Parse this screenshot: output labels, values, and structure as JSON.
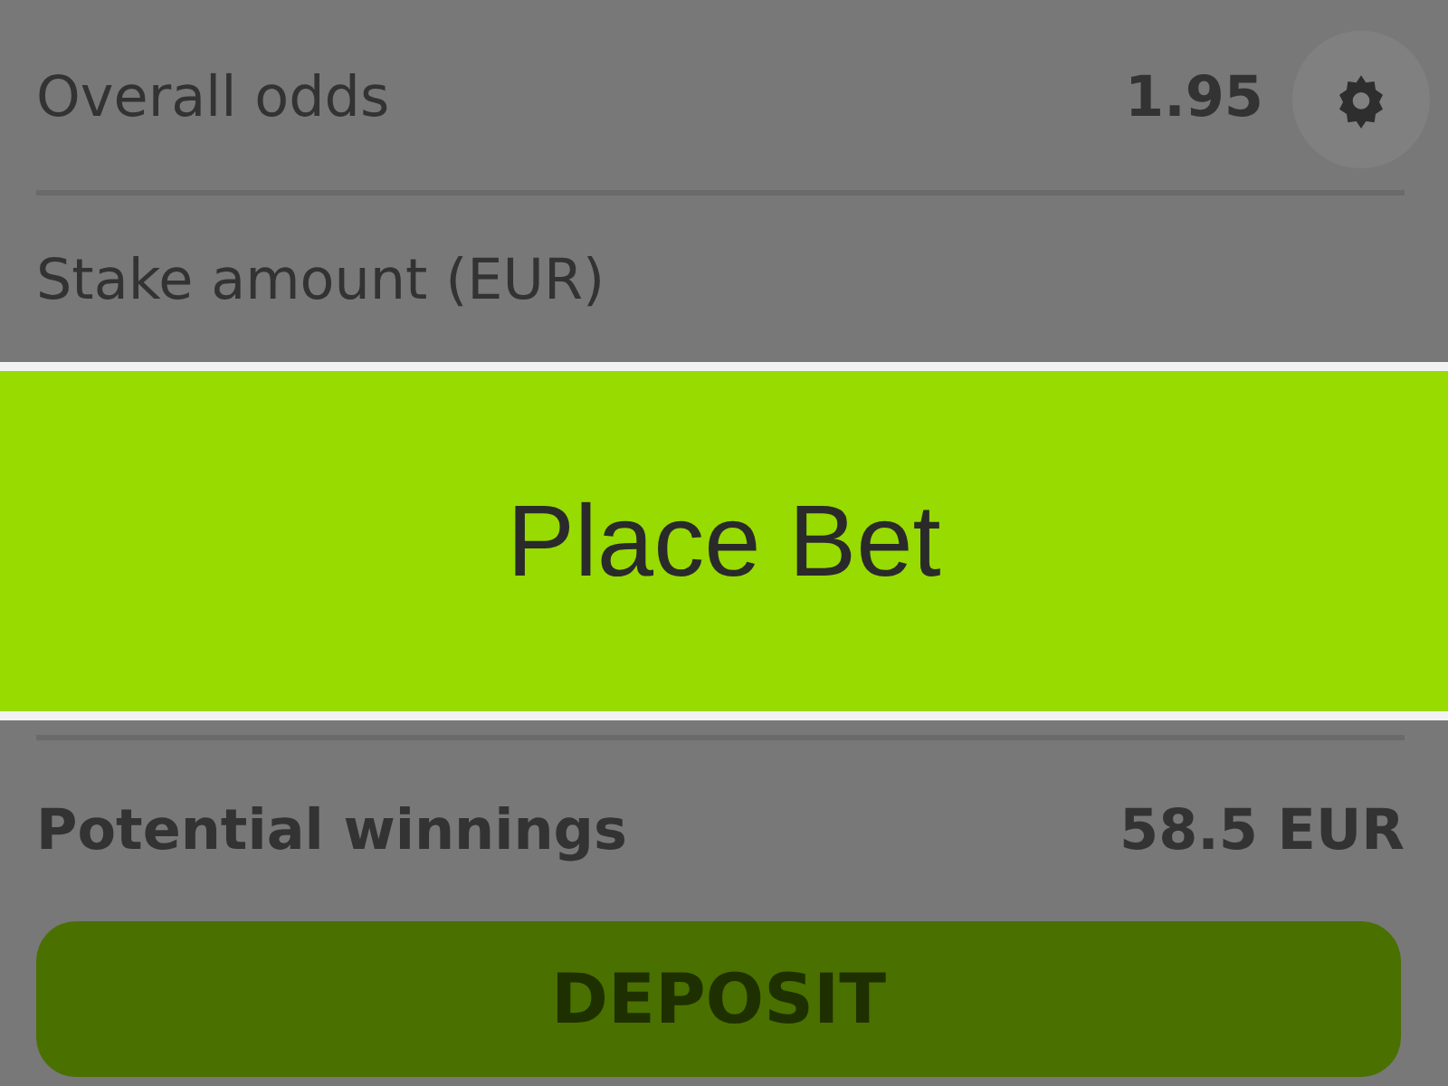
{
  "bet_slip": {
    "odds_label": "Overall odds",
    "odds_value": "1.95",
    "stake_label": "Stake amount (EUR)",
    "winnings_label": "Potential winnings",
    "winnings_value": "58.5 EUR",
    "deposit_button": "DEPOSIT"
  },
  "place_bet_button": "Place Bet"
}
